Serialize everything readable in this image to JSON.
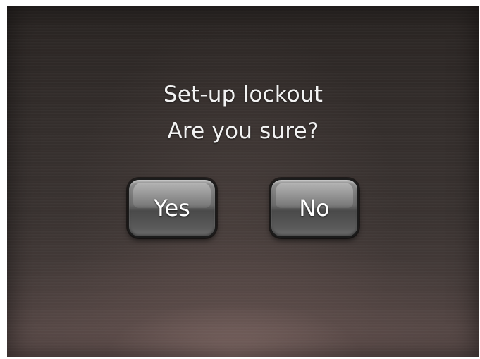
{
  "dialog": {
    "title": "Set-up lockout",
    "message": "Are you sure?",
    "yes_label": "Yes",
    "no_label": "No"
  },
  "colors": {
    "background_dark": "#2a2523",
    "background_glow": "#5a4b49",
    "text": "#f2f2f2",
    "button": "#6a6a6a"
  }
}
